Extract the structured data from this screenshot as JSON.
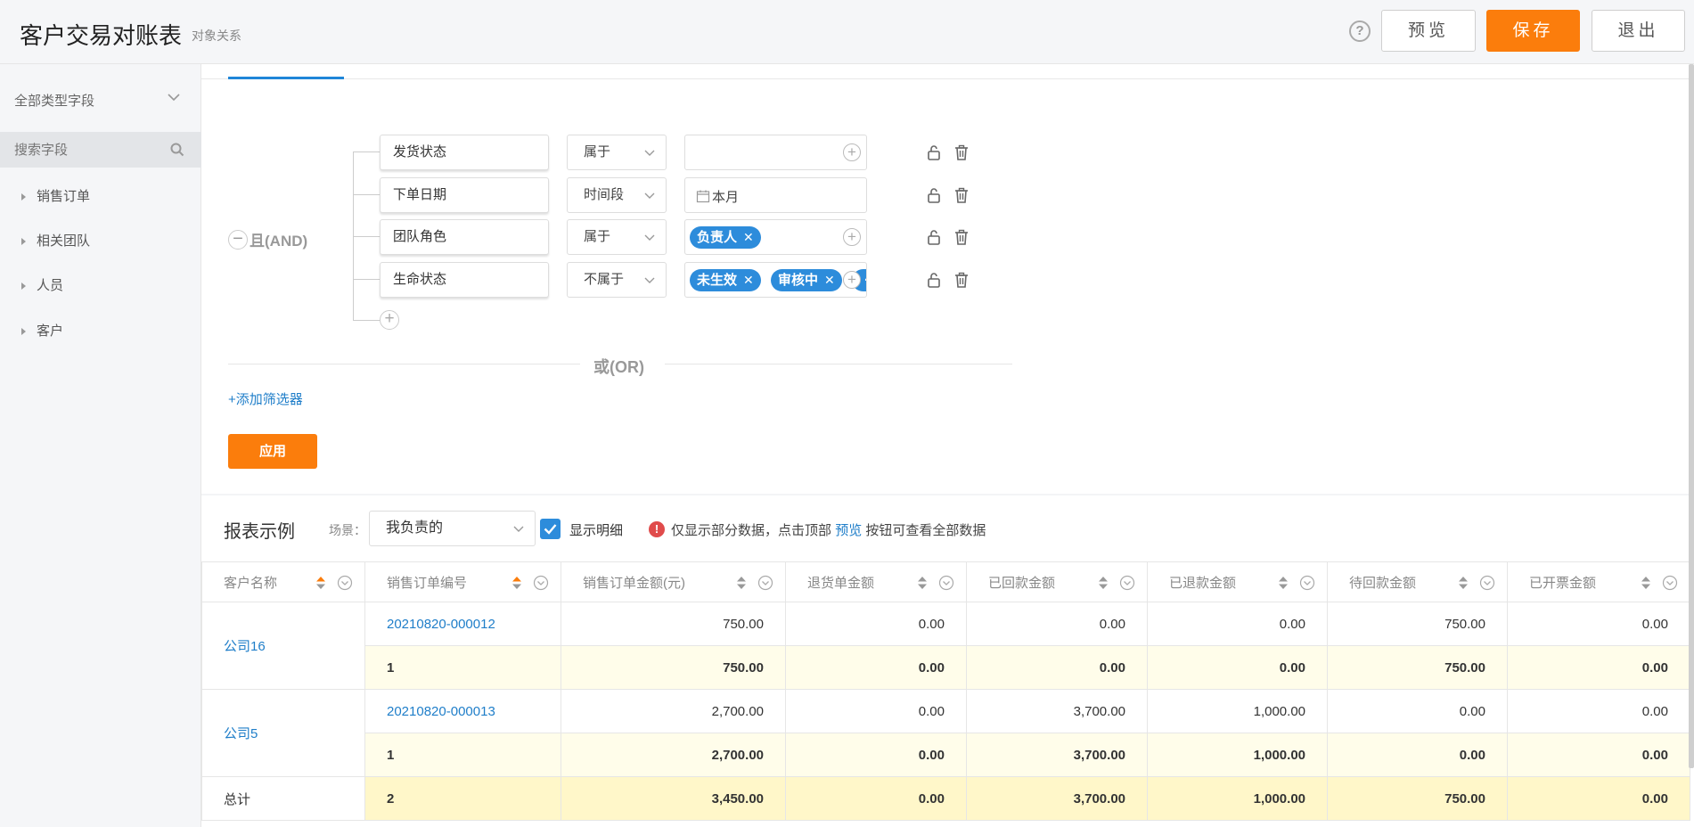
{
  "header": {
    "title": "客户交易对账表",
    "subtitle": "对象关系",
    "help": "?",
    "preview_label": "预览",
    "save_label": "保存",
    "exit_label": "退出"
  },
  "sidebar": {
    "field_type": "全部类型字段",
    "search_placeholder": "搜索字段",
    "items": [
      {
        "label": "销售订单"
      },
      {
        "label": "相关团队"
      },
      {
        "label": "人员"
      },
      {
        "label": "客户"
      }
    ]
  },
  "filters": {
    "logic_and": "且(AND)",
    "logic_or": "或(OR)",
    "conditions": [
      {
        "field": "发货状态",
        "operator": "属于",
        "tags": []
      },
      {
        "field": "下单日期",
        "operator": "时间段",
        "value_text": "本月",
        "tags": []
      },
      {
        "field": "团队角色",
        "operator": "属于",
        "tags": [
          {
            "label": "负责人"
          }
        ]
      },
      {
        "field": "生命状态",
        "operator": "不属于",
        "tags": [
          {
            "label": "未生效"
          },
          {
            "label": "审核中"
          },
          {
            "label": "···"
          }
        ]
      }
    ],
    "add_filter": "+添加筛选器",
    "apply_label": "应用"
  },
  "report": {
    "title": "报表示例",
    "scene_label": "场景：",
    "scene_value": "我负责的",
    "show_detail_label": "显示明细",
    "show_detail_checked": true,
    "notice_prefix": "仅显示部分数据，点击顶部",
    "notice_link": "预览",
    "notice_suffix": "按钮可查看全部数据",
    "columns": [
      "客户名称",
      "销售订单编号",
      "销售订单金额(元)",
      "退货单金额",
      "已回款金额",
      "已退款金额",
      "待回款金额",
      "已开票金额"
    ],
    "groups": [
      {
        "customer": "公司16",
        "detail": [
          "20210820-000012",
          "750.00",
          "0.00",
          "0.00",
          "0.00",
          "750.00",
          "0.00"
        ],
        "subtotal": [
          "1",
          "750.00",
          "0.00",
          "0.00",
          "0.00",
          "750.00",
          "0.00"
        ]
      },
      {
        "customer": "公司5",
        "detail": [
          "20210820-000013",
          "2,700.00",
          "0.00",
          "3,700.00",
          "1,000.00",
          "0.00",
          "0.00"
        ],
        "subtotal": [
          "1",
          "2,700.00",
          "0.00",
          "3,700.00",
          "1,000.00",
          "0.00",
          "0.00"
        ]
      }
    ],
    "total_label": "总计",
    "total": [
      "2",
      "3,450.00",
      "0.00",
      "3,700.00",
      "1,000.00",
      "750.00",
      "0.00"
    ]
  },
  "colors": {
    "accent_orange": "#fb7d0c",
    "accent_blue": "#2d8cdb",
    "link_blue": "#1f7ec9"
  }
}
